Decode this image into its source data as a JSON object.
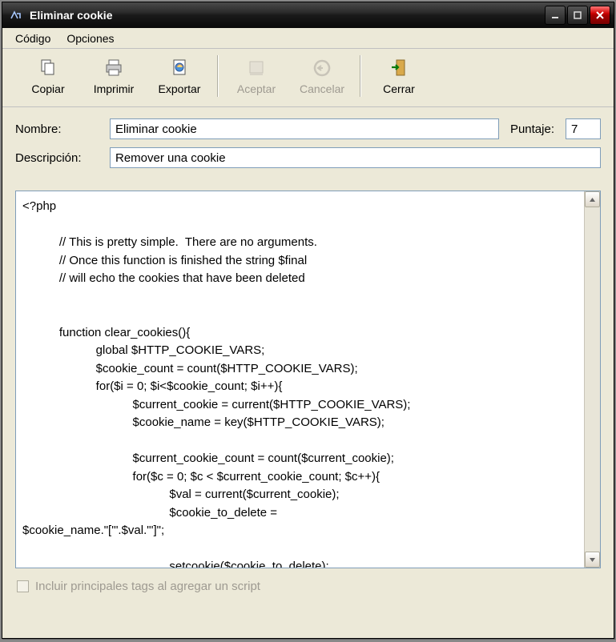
{
  "window": {
    "title": "Eliminar cookie"
  },
  "menu": {
    "items": [
      "Código",
      "Opciones"
    ]
  },
  "toolbar": {
    "copy": "Copiar",
    "print": "Imprimir",
    "export": "Exportar",
    "accept": "Aceptar",
    "cancel": "Cancelar",
    "close": "Cerrar"
  },
  "form": {
    "name_label": "Nombre:",
    "name_value": "Eliminar cookie",
    "score_label": "Puntaje:",
    "score_value": "7",
    "desc_label": "Descripción:",
    "desc_value": "Remover una cookie"
  },
  "code": "<?php\n\n           // This is pretty simple.  There are no arguments.\n           // Once this function is finished the string $final\n           // will echo the cookies that have been deleted\n\n\n           function clear_cookies(){\n                      global $HTTP_COOKIE_VARS;\n                      $cookie_count = count($HTTP_COOKIE_VARS);\n                      for($i = 0; $i<$cookie_count; $i++){\n                                 $current_cookie = current($HTTP_COOKIE_VARS);\n                                 $cookie_name = key($HTTP_COOKIE_VARS);\n\n                                 $current_cookie_count = count($current_cookie);\n                                 for($c = 0; $c < $current_cookie_count; $c++){\n                                            $val = current($current_cookie);\n                                            $cookie_to_delete =\n$cookie_name.\"['\".$val.\"']\";\n\n                                            setcookie($cookie_to_delete);",
  "footer": {
    "include_tags": "Incluir principales tags al agregar un script"
  }
}
